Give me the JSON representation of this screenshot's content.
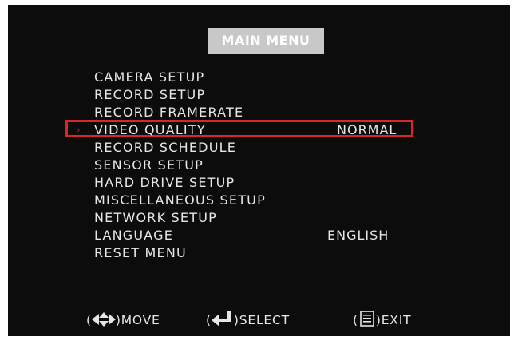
{
  "title": "MAIN MENU",
  "selected_marker": "›",
  "menu": {
    "items": [
      {
        "label": "CAMERA SETUP",
        "value": ""
      },
      {
        "label": "RECORD SETUP",
        "value": ""
      },
      {
        "label": "RECORD FRAMERATE",
        "value": ""
      },
      {
        "label": "VIDEO QUALITY",
        "value": "NORMAL",
        "selected": true
      },
      {
        "label": "RECORD SCHEDULE",
        "value": ""
      },
      {
        "label": "SENSOR SETUP",
        "value": ""
      },
      {
        "label": "HARD DRIVE SETUP",
        "value": ""
      },
      {
        "label": "MISCELLANEOUS SETUP",
        "value": ""
      },
      {
        "label": "NETWORK SETUP",
        "value": ""
      },
      {
        "label": "LANGUAGE",
        "value": "ENGLISH"
      },
      {
        "label": "RESET MENU",
        "value": ""
      }
    ]
  },
  "footer": {
    "move_label": "MOVE",
    "select_label": "SELECT",
    "exit_label": "EXIT",
    "open_paren": "(",
    "close_paren": ")"
  },
  "colors": {
    "background": "#0c0c0c",
    "title_bar": "#c8c8c8",
    "text": "#e6e6e6",
    "highlight": "#d9262b"
  },
  "icons": {
    "move": "four-way-arrow-icon",
    "select": "enter-arrow-icon",
    "exit": "menu-list-icon"
  }
}
